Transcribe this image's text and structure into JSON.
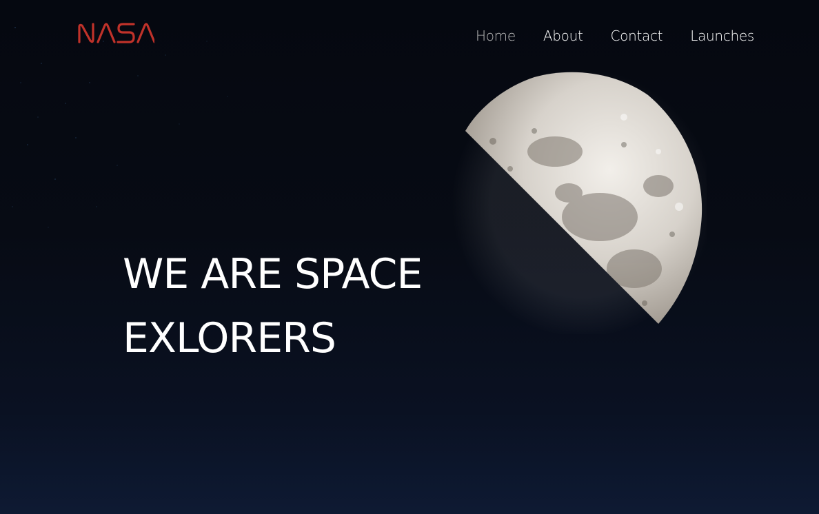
{
  "brand": {
    "logo_text": "NASA",
    "logo_color": "#c0322a"
  },
  "nav": {
    "items": [
      {
        "label": "Home",
        "active": true
      },
      {
        "label": "About",
        "active": false
      },
      {
        "label": "Contact",
        "active": false
      },
      {
        "label": "Launches",
        "active": false
      }
    ]
  },
  "hero": {
    "headline_line1": "WE ARE SPACE",
    "headline_line2": "EXLORERS",
    "background_image": "half-moon-icon"
  },
  "colors": {
    "background": "#070b14",
    "text": "#ffffff",
    "nav_active": "#bcbcbc"
  }
}
